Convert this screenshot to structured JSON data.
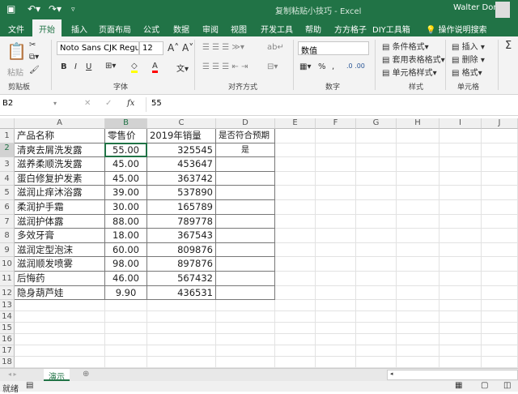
{
  "titlebar": {
    "title": "复制粘贴小技巧  -  Excel",
    "user": "Walter Dong",
    "save_icon": "save-icon",
    "undo_icon": "undo-icon",
    "redo_icon": "redo-icon"
  },
  "tabs": [
    "文件",
    "开始",
    "插入",
    "页面布局",
    "公式",
    "数据",
    "审阅",
    "视图",
    "开发工具",
    "帮助",
    "方方格子",
    "DIY工具箱"
  ],
  "active_tab": "开始",
  "search_label": "操作说明搜索",
  "ribbon": {
    "paste": "粘贴",
    "clipboard": "剪贴板",
    "font_name": "Noto Sans CJK Regul",
    "font_size": "12",
    "font_group": "字体",
    "bold": "B",
    "italic": "I",
    "underline": "U",
    "font_color": "A",
    "align_group": "对齐方式",
    "number_format": "数值",
    "number_group": "数字",
    "percent": "%",
    "comma": ",",
    "cond_format": "条件格式",
    "table_format": "套用表格格式",
    "cell_style": "单元格样式",
    "style_group": "样式",
    "insert": "插入",
    "delete": "删除",
    "format": "格式",
    "cells_group": "单元格",
    "colors": {
      "highlight": "#ffff00",
      "font": "#ff0000"
    }
  },
  "formula_bar": {
    "name_box": "B2",
    "fx": "fx",
    "value": "55"
  },
  "columns": [
    "A",
    "B",
    "C",
    "D",
    "E",
    "F",
    "G",
    "H",
    "I",
    "J"
  ],
  "rows": [
    "1",
    "2",
    "3",
    "4",
    "5",
    "6",
    "7",
    "8",
    "9",
    "10",
    "11",
    "12",
    "13",
    "14",
    "15",
    "16",
    "17",
    "18"
  ],
  "table": {
    "headers": [
      "产品名称",
      "零售价",
      "2019年销量",
      "是否符合预期"
    ],
    "rows": [
      [
        "清爽去屑洗发露",
        "55.00",
        "325545",
        "是"
      ],
      [
        "滋养柔顺洗发露",
        "45.00",
        "453647",
        ""
      ],
      [
        "蛋白修复护发素",
        "45.00",
        "363742",
        ""
      ],
      [
        "滋润止痒沐浴露",
        "39.00",
        "537890",
        ""
      ],
      [
        "柔润护手霜",
        "30.00",
        "165789",
        ""
      ],
      [
        "滋润护体露",
        "88.00",
        "789778",
        ""
      ],
      [
        "多效牙膏",
        "18.00",
        "367543",
        ""
      ],
      [
        "滋润定型泡沫",
        "60.00",
        "809876",
        ""
      ],
      [
        "滋润顺发喷雾",
        "98.00",
        "897876",
        ""
      ],
      [
        "后悔药",
        "46.00",
        "567432",
        ""
      ],
      [
        "隐身葫芦娃",
        "9.90",
        "436531",
        ""
      ]
    ]
  },
  "sheet_tab": "演示",
  "status": "就绪"
}
